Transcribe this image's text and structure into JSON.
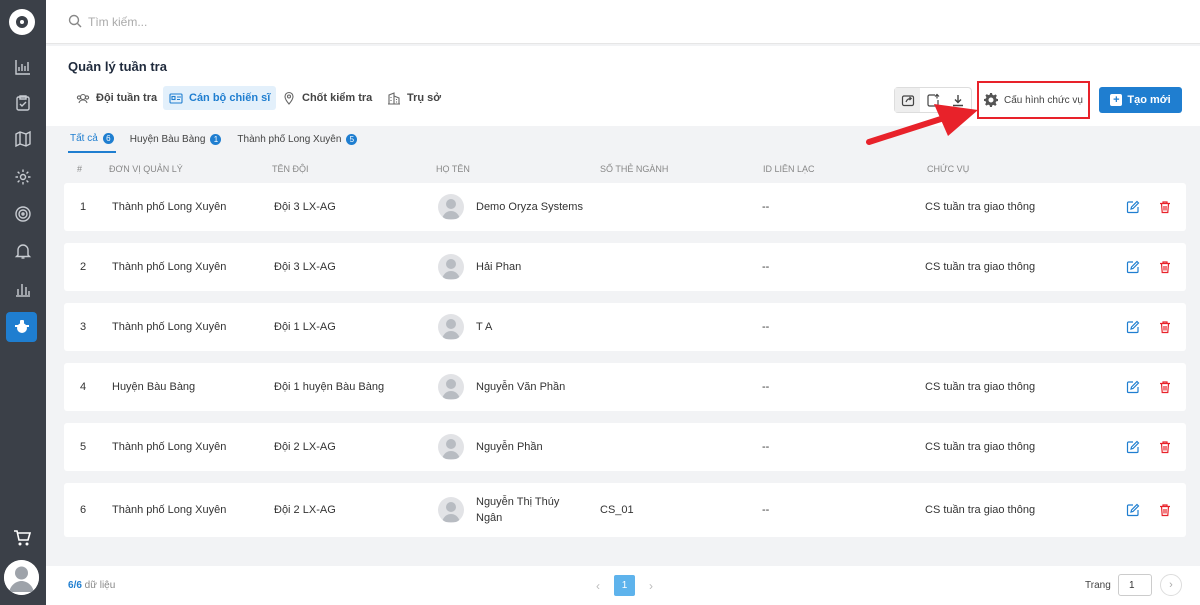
{
  "search": {
    "placeholder": "Tìm kiếm..."
  },
  "header": {
    "title": "Quản lý tuần tra",
    "tabs": [
      {
        "label": "Đội tuần tra",
        "icon": "group-icon"
      },
      {
        "label": "Cán bộ chiến sĩ",
        "icon": "id-card-icon",
        "active": true
      },
      {
        "label": "Chốt kiểm tra",
        "icon": "location-pin-icon"
      },
      {
        "label": "Trụ sở",
        "icon": "building-icon"
      }
    ],
    "config_label": "Cấu hình chức vụ",
    "create_label": "Tạo mới"
  },
  "filters": [
    {
      "label": "Tất cả",
      "count": "6",
      "active": true
    },
    {
      "label": "Huyện Bàu Bàng",
      "count": "1"
    },
    {
      "label": "Thành phố Long Xuyên",
      "count": "5"
    }
  ],
  "table": {
    "headers": [
      "#",
      "ĐƠN VỊ QUẢN LÝ",
      "TÊN ĐỘI",
      "HỌ TÊN",
      "SỐ THẺ NGÀNH",
      "ID LIÊN LẠC",
      "CHỨC VỤ"
    ],
    "rows": [
      {
        "no": "1",
        "unit": "Thành phố Long Xuyên",
        "team": "Đội 3 LX-AG",
        "name": "Demo Oryza Systems",
        "name2": "",
        "card": "",
        "contact": "--",
        "position": "CS tuần tra giao thông"
      },
      {
        "no": "2",
        "unit": "Thành phố Long Xuyên",
        "team": "Đội 3 LX-AG",
        "name": "Hải Phan",
        "name2": "",
        "card": "",
        "contact": "--",
        "position": "CS tuần tra giao thông"
      },
      {
        "no": "3",
        "unit": "Thành phố Long Xuyên",
        "team": "Đội 1 LX-AG",
        "name": "T A",
        "name2": "",
        "card": "",
        "contact": "--",
        "position": ""
      },
      {
        "no": "4",
        "unit": "Huyện Bàu Bàng",
        "team": "Đội 1 huyện Bàu Bàng",
        "name": "Nguyễn Văn Phần",
        "name2": "",
        "card": "",
        "contact": "--",
        "position": "CS tuần tra giao thông"
      },
      {
        "no": "5",
        "unit": "Thành phố Long Xuyên",
        "team": "Đội 2 LX-AG",
        "name": "Nguyễn Phần",
        "name2": "",
        "card": "",
        "contact": "--",
        "position": "CS tuần tra giao thông"
      },
      {
        "no": "6",
        "unit": "Thành phố Long Xuyên",
        "team": "Đội 2 LX-AG",
        "name": "Nguyễn Thị Thúy",
        "name2": "Ngân",
        "card": "CS_01",
        "contact": "--",
        "position": "CS tuần tra giao thông"
      }
    ]
  },
  "footer": {
    "count_shown": "6",
    "count_total": "/6",
    "count_suffix": " dữ liệu",
    "current_page": "1",
    "page_label": "Trang",
    "page_input": "1"
  },
  "colors": {
    "accent": "#1f7ed0",
    "danger": "#e8222a",
    "sidebar": "#3b4048"
  }
}
